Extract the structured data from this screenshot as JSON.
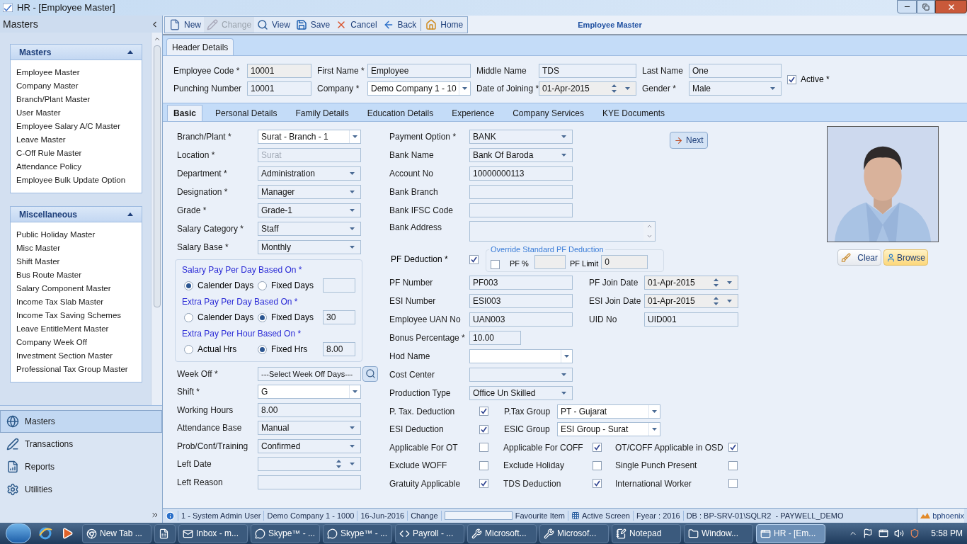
{
  "window": {
    "title": "HR - [Employee Master]"
  },
  "sidebar": {
    "title": "Masters",
    "groups": [
      {
        "title": "Masters",
        "expanded": true,
        "items": [
          "Employee Master",
          "Company Master",
          "Branch/Plant Master",
          "User Master",
          "Employee Salary A/C Master",
          "Leave Master",
          "C-Off Rule Master",
          "Attendance Policy",
          "Employee Bulk Update Option"
        ]
      },
      {
        "title": "Miscellaneous",
        "expanded": true,
        "items": [
          "Public Holiday Master",
          "Misc Master",
          "Shift Master",
          "Bus Route Master",
          "Salary Component Master",
          "Income Tax Slab Master",
          "Income Tax Saving Schemes",
          "Leave EntitleMent Master",
          "Company Week Off",
          "Investment Section Master",
          "Professional Tax Group Master"
        ]
      }
    ],
    "nav": [
      {
        "label": "Masters",
        "kind": "globe",
        "selected": true
      },
      {
        "label": "Transactions",
        "kind": "pen",
        "selected": false
      },
      {
        "label": "Reports",
        "kind": "report",
        "selected": false
      },
      {
        "label": "Utilities",
        "kind": "gear",
        "selected": false
      }
    ]
  },
  "toolbar": {
    "title": "Employee Master",
    "buttons": [
      {
        "label": "New",
        "kind": "new",
        "disabled": false
      },
      {
        "label": "Change",
        "kind": "change",
        "disabled": true
      },
      {
        "label": "View",
        "kind": "view",
        "disabled": false
      },
      {
        "label": "Save",
        "kind": "save",
        "disabled": false
      },
      {
        "label": "Cancel",
        "kind": "cancel",
        "disabled": false
      },
      {
        "label": "Back",
        "kind": "back",
        "disabled": false
      },
      {
        "label": "Home",
        "kind": "home",
        "disabled": false
      }
    ]
  },
  "header": {
    "tab": "Header Details",
    "rows": [
      [
        {
          "label": "Employee Code *",
          "value": "10001",
          "kind": "locked"
        },
        {
          "label": "First Name *",
          "value": "Employee",
          "kind": "text"
        },
        {
          "label": "Middle Name",
          "value": "TDS",
          "kind": "text"
        },
        {
          "label": "Last Name",
          "value": "One",
          "kind": "text"
        }
      ],
      [
        {
          "label": "Punching Number",
          "value": "10001",
          "kind": "text"
        },
        {
          "label": "Company *",
          "value": "Demo Company 1 - 10",
          "kind": "combo"
        },
        {
          "label": "Date of Joining *",
          "value": "01-Apr-2015",
          "kind": "date"
        },
        {
          "label": "Gender *",
          "value": "Male",
          "kind": "select"
        }
      ]
    ],
    "active": {
      "label": "Active *",
      "checked": true
    }
  },
  "tabs": [
    {
      "label": "Basic",
      "selected": true
    },
    {
      "label": "Personal Details",
      "selected": false
    },
    {
      "label": "Family Details",
      "selected": false
    },
    {
      "label": "Education Details",
      "selected": false
    },
    {
      "label": "Experience",
      "selected": false
    },
    {
      "label": "Company Services",
      "selected": false
    },
    {
      "label": "KYE Documents",
      "selected": false
    }
  ],
  "basic": {
    "left_top": [
      {
        "label": "Branch/Plant *",
        "value": "Surat - Branch - 1",
        "kind": "combo"
      },
      {
        "label": "Location *",
        "value": "Surat",
        "kind": "disabled"
      },
      {
        "label": "Department *",
        "value": "Administration",
        "kind": "select"
      },
      {
        "label": "Designation *",
        "value": "Manager",
        "kind": "select"
      },
      {
        "label": "Grade *",
        "value": "Grade-1",
        "kind": "select"
      },
      {
        "label": "Salary Category *",
        "value": "Staff",
        "kind": "select"
      },
      {
        "label": "Salary Base *",
        "value": "Monthly",
        "kind": "select"
      }
    ],
    "pay_basis": [
      {
        "title": "Salary Pay Per Day Based On *",
        "options": [
          {
            "label": "Calender Days",
            "selected": true
          },
          {
            "label": "Fixed Days",
            "selected": false
          }
        ]
      },
      {
        "title": "Extra Pay Per Day Based On *",
        "options": [
          {
            "label": "Calender Days",
            "selected": false
          },
          {
            "label": "Fixed Days",
            "selected": true
          }
        ],
        "value": "30"
      },
      {
        "title": "Extra Pay Per Hour Based On *",
        "options": [
          {
            "label": "Actual Hrs",
            "selected": false
          },
          {
            "label": "Fixed Hrs",
            "selected": true
          }
        ],
        "value": "8.00"
      }
    ],
    "left_bottom": [
      {
        "label": "Week Off *",
        "value": "---Select Week Off Days---",
        "kind": "search"
      },
      {
        "label": "Shift *",
        "value": "G",
        "kind": "combo"
      },
      {
        "label": "Working Hours",
        "value": "8.00",
        "kind": "text"
      },
      {
        "label": "Attendance Base",
        "value": "Manual",
        "kind": "select"
      },
      {
        "label": "Prob/Conf/Training",
        "value": "Confirmed",
        "kind": "select"
      },
      {
        "label": "Left Date",
        "kind": "date"
      },
      {
        "label": "Left Reason",
        "kind": "text"
      }
    ],
    "middle_top": [
      {
        "label": "Payment Option *",
        "value": "BANK",
        "kind": "select"
      },
      {
        "label": "Bank Name",
        "value": "Bank Of Baroda",
        "kind": "select"
      },
      {
        "label": "Account No",
        "value": "10000000113",
        "kind": "text"
      },
      {
        "label": "Bank Branch",
        "kind": "text"
      },
      {
        "label": "Bank IFSC Code",
        "kind": "text"
      },
      {
        "label": "Bank Address",
        "kind": "memo"
      }
    ],
    "next_button": "Next",
    "pf": {
      "label": "PF Deduction *",
      "checked": true,
      "override": {
        "title": "Override Standard PF Deduction",
        "checked": false,
        "percent_label": "PF %",
        "limit_label": "PF Limit",
        "limit": "0"
      }
    },
    "middle_rows": [
      {
        "label": "PF Number",
        "value": "PF003",
        "kind": "text",
        "side": {
          "label": "PF Join Date",
          "value": "01-Apr-2015",
          "kind": "date"
        }
      },
      {
        "label": "ESI Number",
        "value": "ESI003",
        "kind": "text",
        "side": {
          "label": "ESI Join Date",
          "value": "01-Apr-2015",
          "kind": "date"
        }
      },
      {
        "label": "Employee UAN No",
        "value": "UAN003",
        "kind": "text",
        "side": {
          "label": "UID No",
          "value": "UID001",
          "kind": "text"
        }
      },
      {
        "label": "Bonus Percentage *",
        "value": "10.00",
        "kind": "short"
      },
      {
        "label": "Hod Name",
        "kind": "combo"
      },
      {
        "label": "Cost Center",
        "kind": "select"
      },
      {
        "label": "Production Type",
        "value": "Office Un Skilled",
        "kind": "select"
      }
    ],
    "deductions": [
      {
        "label": "P. Tax. Deduction",
        "checked": true,
        "group_label": "P.Tax Group",
        "group_value": "PT - Gujarat"
      },
      {
        "label": "ESI Deduction",
        "checked": true,
        "group_label": "ESIC Group",
        "group_value": "ESI Group - Surat"
      }
    ],
    "flags": [
      {
        "items": [
          {
            "label": "Applicable For OT",
            "checked": false
          },
          {
            "label": "Applicable For COFF",
            "checked": true
          },
          {
            "label": "OT/COFF Applicable in OSD",
            "checked": true
          }
        ]
      },
      {
        "items": [
          {
            "label": "Exclude WOFF",
            "checked": false
          },
          {
            "label": "Exclude Holiday",
            "checked": false
          },
          {
            "label": "Single Punch Present",
            "checked": false
          }
        ]
      },
      {
        "items": [
          {
            "label": "Gratuity Applicable",
            "checked": true
          },
          {
            "label": "TDS Deduction",
            "checked": true
          },
          {
            "label": "International Worker",
            "checked": false
          }
        ]
      }
    ],
    "photo": {
      "kind": "picture",
      "buttons": [
        "Clear",
        "Browse"
      ]
    }
  },
  "status_bar": {
    "items": [
      "1 - System Admin User",
      "Demo Company 1 - 1000",
      "16-Jun-2016",
      "Change"
    ],
    "favourite": "Favourite Item",
    "active_screen": "Active Screen",
    "fyear": "Fyear : 2016",
    "db": "DB : BP-SRV-01\\SQLR2  - PAYWELL_DEMO",
    "brand": "bphoenix"
  },
  "taskbar": {
    "items": [
      {
        "kind": "browser",
        "label": "New Tab ...",
        "selected": false
      },
      {
        "kind": "sheet",
        "selected": false
      },
      {
        "kind": "mail",
        "label": "Inbox - m...",
        "selected": false
      },
      {
        "kind": "chat",
        "label": "Skype™ - ...",
        "selected": false
      },
      {
        "kind": "chat",
        "label": "Skype™ - ...",
        "selected": false
      },
      {
        "kind": "studio",
        "label": "Payroll - ...",
        "selected": false
      },
      {
        "kind": "tool",
        "label": "Microsoft...",
        "selected": false
      },
      {
        "kind": "tool",
        "label": "Microsof...",
        "selected": false
      },
      {
        "kind": "notepad",
        "label": "Notepad",
        "selected": false
      },
      {
        "kind": "folder",
        "label": "Window...",
        "selected": false
      },
      {
        "kind": "app",
        "label": "HR - [Em...",
        "selected": true
      }
    ],
    "time": "5:58 PM"
  }
}
